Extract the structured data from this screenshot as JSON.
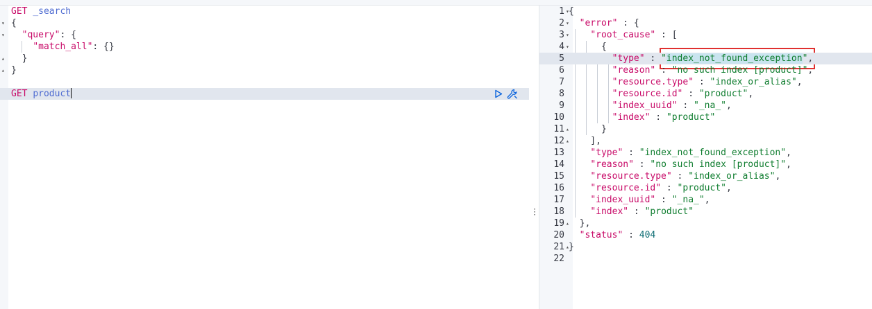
{
  "request_editor": {
    "lines": [
      {
        "fold": "",
        "parts": [
          {
            "t": "method",
            "v": "GET"
          },
          {
            "t": "punc",
            "v": " "
          },
          {
            "t": "path",
            "v": "_search"
          }
        ]
      },
      {
        "fold": "▾",
        "parts": [
          {
            "t": "punc",
            "v": "{"
          }
        ]
      },
      {
        "fold": "▾",
        "parts": [
          {
            "t": "punc",
            "v": "  "
          },
          {
            "t": "key",
            "v": "\"query\""
          },
          {
            "t": "punc",
            "v": ": {"
          }
        ]
      },
      {
        "fold": "",
        "parts": [
          {
            "t": "punc",
            "v": "    "
          },
          {
            "t": "key",
            "v": "\"match_all\""
          },
          {
            "t": "punc",
            "v": ": {}"
          }
        ]
      },
      {
        "fold": "▴",
        "parts": [
          {
            "t": "punc",
            "v": "  }"
          }
        ]
      },
      {
        "fold": "▴",
        "parts": [
          {
            "t": "punc",
            "v": "}"
          }
        ]
      },
      {
        "fold": "",
        "parts": []
      },
      {
        "fold": "",
        "parts": [
          {
            "t": "method",
            "v": "GET"
          },
          {
            "t": "punc",
            "v": " "
          },
          {
            "t": "path",
            "v": "product"
          }
        ],
        "active": true,
        "cursor": true
      }
    ],
    "play_icon": "play-icon",
    "wrench_icon": "wrench-icon"
  },
  "response_output": {
    "highlighted_value": "index_not_found_exception",
    "lines": [
      {
        "n": "1",
        "fold": "▾",
        "parts": [
          {
            "t": "punc",
            "v": "{"
          }
        ]
      },
      {
        "n": "2",
        "fold": "▾",
        "parts": [
          {
            "t": "punc",
            "v": "  "
          },
          {
            "t": "key",
            "v": "\"error\""
          },
          {
            "t": "punc",
            "v": " : {"
          }
        ]
      },
      {
        "n": "3",
        "fold": "▾",
        "parts": [
          {
            "t": "punc",
            "v": "    "
          },
          {
            "t": "key",
            "v": "\"root_cause\""
          },
          {
            "t": "punc",
            "v": " : ["
          }
        ]
      },
      {
        "n": "4",
        "fold": "▾",
        "parts": [
          {
            "t": "punc",
            "v": "      {"
          }
        ]
      },
      {
        "n": "5",
        "fold": "",
        "active": true,
        "parts": [
          {
            "t": "punc",
            "v": "        "
          },
          {
            "t": "key",
            "v": "\"type\""
          },
          {
            "t": "punc",
            "v": " : "
          },
          {
            "t": "str",
            "v": "\""
          },
          {
            "t": "str",
            "v": "index_not_found_exception",
            "hl": true
          },
          {
            "t": "str",
            "v": "\""
          },
          {
            "t": "punc",
            "v": ","
          }
        ]
      },
      {
        "n": "6",
        "fold": "",
        "parts": [
          {
            "t": "punc",
            "v": "        "
          },
          {
            "t": "key",
            "v": "\"reason\""
          },
          {
            "t": "punc",
            "v": " : "
          },
          {
            "t": "str",
            "v": "\"no such index [product]\""
          },
          {
            "t": "punc",
            "v": ","
          }
        ]
      },
      {
        "n": "7",
        "fold": "",
        "parts": [
          {
            "t": "punc",
            "v": "        "
          },
          {
            "t": "key",
            "v": "\"resource.type\""
          },
          {
            "t": "punc",
            "v": " : "
          },
          {
            "t": "str",
            "v": "\"index_or_alias\""
          },
          {
            "t": "punc",
            "v": ","
          }
        ]
      },
      {
        "n": "8",
        "fold": "",
        "parts": [
          {
            "t": "punc",
            "v": "        "
          },
          {
            "t": "key",
            "v": "\"resource.id\""
          },
          {
            "t": "punc",
            "v": " : "
          },
          {
            "t": "str",
            "v": "\"product\""
          },
          {
            "t": "punc",
            "v": ","
          }
        ]
      },
      {
        "n": "9",
        "fold": "",
        "parts": [
          {
            "t": "punc",
            "v": "        "
          },
          {
            "t": "key",
            "v": "\"index_uuid\""
          },
          {
            "t": "punc",
            "v": " : "
          },
          {
            "t": "str",
            "v": "\"_na_\""
          },
          {
            "t": "punc",
            "v": ","
          }
        ]
      },
      {
        "n": "10",
        "fold": "",
        "parts": [
          {
            "t": "punc",
            "v": "        "
          },
          {
            "t": "key",
            "v": "\"index\""
          },
          {
            "t": "punc",
            "v": " : "
          },
          {
            "t": "str",
            "v": "\"product\""
          }
        ]
      },
      {
        "n": "11",
        "fold": "▴",
        "parts": [
          {
            "t": "punc",
            "v": "      }"
          }
        ]
      },
      {
        "n": "12",
        "fold": "▴",
        "parts": [
          {
            "t": "punc",
            "v": "    ],"
          }
        ]
      },
      {
        "n": "13",
        "fold": "",
        "parts": [
          {
            "t": "punc",
            "v": "    "
          },
          {
            "t": "key",
            "v": "\"type\""
          },
          {
            "t": "punc",
            "v": " : "
          },
          {
            "t": "str",
            "v": "\"index_not_found_exception\""
          },
          {
            "t": "punc",
            "v": ","
          }
        ]
      },
      {
        "n": "14",
        "fold": "",
        "parts": [
          {
            "t": "punc",
            "v": "    "
          },
          {
            "t": "key",
            "v": "\"reason\""
          },
          {
            "t": "punc",
            "v": " : "
          },
          {
            "t": "str",
            "v": "\"no such index [product]\""
          },
          {
            "t": "punc",
            "v": ","
          }
        ]
      },
      {
        "n": "15",
        "fold": "",
        "parts": [
          {
            "t": "punc",
            "v": "    "
          },
          {
            "t": "key",
            "v": "\"resource.type\""
          },
          {
            "t": "punc",
            "v": " : "
          },
          {
            "t": "str",
            "v": "\"index_or_alias\""
          },
          {
            "t": "punc",
            "v": ","
          }
        ]
      },
      {
        "n": "16",
        "fold": "",
        "parts": [
          {
            "t": "punc",
            "v": "    "
          },
          {
            "t": "key",
            "v": "\"resource.id\""
          },
          {
            "t": "punc",
            "v": " : "
          },
          {
            "t": "str",
            "v": "\"product\""
          },
          {
            "t": "punc",
            "v": ","
          }
        ]
      },
      {
        "n": "17",
        "fold": "",
        "parts": [
          {
            "t": "punc",
            "v": "    "
          },
          {
            "t": "key",
            "v": "\"index_uuid\""
          },
          {
            "t": "punc",
            "v": " : "
          },
          {
            "t": "str",
            "v": "\"_na_\""
          },
          {
            "t": "punc",
            "v": ","
          }
        ]
      },
      {
        "n": "18",
        "fold": "",
        "parts": [
          {
            "t": "punc",
            "v": "    "
          },
          {
            "t": "key",
            "v": "\"index\""
          },
          {
            "t": "punc",
            "v": " : "
          },
          {
            "t": "str",
            "v": "\"product\""
          }
        ]
      },
      {
        "n": "19",
        "fold": "▴",
        "parts": [
          {
            "t": "punc",
            "v": "  },"
          }
        ]
      },
      {
        "n": "20",
        "fold": "",
        "parts": [
          {
            "t": "punc",
            "v": "  "
          },
          {
            "t": "key",
            "v": "\"status\""
          },
          {
            "t": "punc",
            "v": " : "
          },
          {
            "t": "num",
            "v": "404"
          }
        ]
      },
      {
        "n": "21",
        "fold": "▴",
        "parts": [
          {
            "t": "punc",
            "v": "}"
          }
        ]
      },
      {
        "n": "22",
        "fold": "",
        "parts": []
      }
    ]
  },
  "colors": {
    "key": "#c80a68",
    "string": "#0f7d2f",
    "number": "#0f6e75",
    "path": "#4e6bd1",
    "active_line": "#e1e6ee",
    "annotation_box": "#e0302f"
  }
}
